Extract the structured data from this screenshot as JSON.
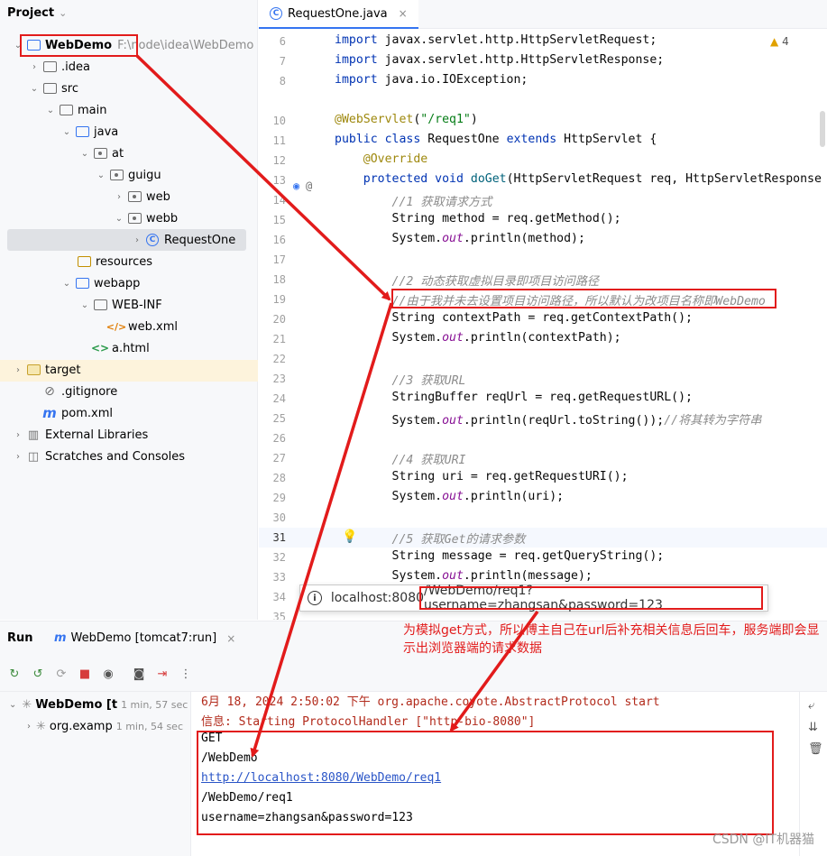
{
  "project_panel": {
    "title": "Project",
    "tree": [
      {
        "label": "WebDemo",
        "hint": "F:\\node\\idea\\WebDemo",
        "icon": "module-folder-icon",
        "arrow": "⌄"
      },
      {
        "label": ".idea",
        "icon": "folder-icon",
        "arrow": "›"
      },
      {
        "label": "src",
        "icon": "folder-icon",
        "arrow": "⌄"
      },
      {
        "label": "main",
        "icon": "folder-icon",
        "arrow": "⌄"
      },
      {
        "label": "java",
        "icon": "source-folder-icon",
        "arrow": "⌄"
      },
      {
        "label": "at",
        "icon": "package-icon",
        "arrow": "⌄"
      },
      {
        "label": "guigu",
        "icon": "package-icon",
        "arrow": "⌄"
      },
      {
        "label": "web",
        "icon": "package-icon",
        "arrow": "›"
      },
      {
        "label": "webb",
        "icon": "package-icon",
        "arrow": "⌄"
      },
      {
        "label": "RequestOne",
        "icon": "class-icon",
        "arrow": "›"
      },
      {
        "label": "resources",
        "icon": "resources-folder-icon",
        "arrow": ""
      },
      {
        "label": "webapp",
        "icon": "web-folder-icon",
        "arrow": "⌄"
      },
      {
        "label": "WEB-INF",
        "icon": "folder-icon",
        "arrow": "⌄"
      },
      {
        "label": "web.xml",
        "icon": "xml-file-icon",
        "arrow": ""
      },
      {
        "label": "a.html",
        "icon": "html-file-icon",
        "arrow": ""
      },
      {
        "label": "target",
        "icon": "excluded-folder-icon",
        "arrow": "›"
      },
      {
        "label": ".gitignore",
        "icon": "gitignore-icon",
        "arrow": ""
      },
      {
        "label": "pom.xml",
        "icon": "maven-icon",
        "arrow": ""
      },
      {
        "label": "External Libraries",
        "icon": "libraries-icon",
        "arrow": "›"
      },
      {
        "label": "Scratches and Consoles",
        "icon": "scratches-icon",
        "arrow": "›"
      }
    ]
  },
  "editor": {
    "tab_label": "RequestOne.java",
    "warning_count": "4",
    "line_numbers": [
      "6",
      "7",
      "8",
      "10",
      "11",
      "12",
      "13",
      "14",
      "15",
      "16",
      "17",
      "18",
      "19",
      "20",
      "21",
      "22",
      "23",
      "24",
      "25",
      "26",
      "27",
      "28",
      "29",
      "30",
      "31",
      "32",
      "33",
      "34",
      "35"
    ]
  },
  "url_popup": {
    "host": "localhost:8080",
    "path": "/WebDemo/req1?username=zhangsan&password=123"
  },
  "run_panel": {
    "title": "Run",
    "tab_label": "WebDemo [tomcat7:run]",
    "tree": [
      {
        "label": "WebDemo [t",
        "time": "1 min, 57 sec"
      },
      {
        "label": "org.examp",
        "time": "1 min, 54 sec"
      }
    ],
    "console": [
      "6月 18, 2024 2:50:02 下午 org.apache.coyote.AbstractProtocol start",
      "信息: Starting ProtocolHandler [\"http-bio-8080\"]",
      "GET",
      "/WebDemo",
      "http://localhost:8080/WebDemo/req1",
      "/WebDemo/req1",
      "username=zhangsan&password=123"
    ]
  },
  "annotation": "为模拟get方式，所以博主自己在url后补充相关信息后回车，服务端即会显示出浏览器端的请求数据",
  "watermark": "CSDN @IT机器猫",
  "colors": {
    "annotation_red": "#e21b1b",
    "accent_blue": "#3574f0"
  }
}
